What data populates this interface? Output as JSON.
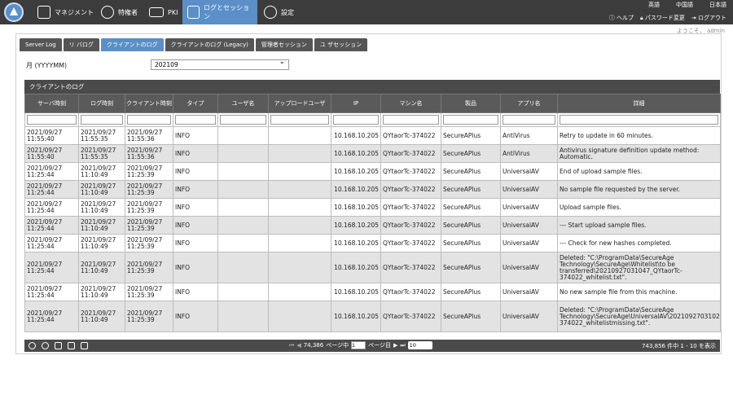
{
  "nav": {
    "items": [
      {
        "label": "マネジメント",
        "icon": "person-lock-icon",
        "active": false
      },
      {
        "label": "特権者",
        "icon": "admin-users-icon",
        "active": false
      },
      {
        "label": "PKI",
        "icon": "certificate-icon",
        "active": false
      },
      {
        "label": "ログとセッション",
        "icon": "log-icon",
        "active": true
      },
      {
        "label": "設定",
        "icon": "gear-icon",
        "active": false
      }
    ],
    "top_right_row1": [
      "英語",
      "中国語",
      "日本語"
    ],
    "help": "ヘルプ",
    "password_change": "パスワード変更",
    "logout": "ログアウト",
    "welcome": "ようこそ、 admin"
  },
  "tabs": [
    {
      "label": "Server Log",
      "active": false
    },
    {
      "label": "リ バログ",
      "active": false
    },
    {
      "label": "クライアントのログ",
      "active": true
    },
    {
      "label": "クライアントのログ (Legacy)",
      "active": false
    },
    {
      "label": "管理者セッション",
      "active": false
    },
    {
      "label": "ユ ザセッション",
      "active": false
    }
  ],
  "filter": {
    "month_label": "月 (YYYYMM)",
    "month_value": "202109"
  },
  "grid": {
    "title": "クライアントのログ",
    "columns": [
      "サーバ時刻",
      "ログ時刻",
      "クライアント時刻",
      "タイプ",
      "ユーザ名",
      "アップロードユーザ",
      "IP",
      "マシン名",
      "製品",
      "アプリ名",
      "詳細"
    ],
    "rows": [
      {
        "server": "2021/09/27 11:55:40",
        "log": "2021/09/27 11:55:35",
        "client": "2021/09/27 11:55:36",
        "type": "INFO",
        "user": "",
        "upload": "",
        "ip": "10.168.10.205",
        "machine": "QYtaorTc-374022",
        "product": "SecureAPlus",
        "app": "AntiVirus",
        "detail": "Retry to update in 60 minutes."
      },
      {
        "server": "2021/09/27 11:55:40",
        "log": "2021/09/27 11:55:35",
        "client": "2021/09/27 11:55:36",
        "type": "INFO",
        "user": "",
        "upload": "",
        "ip": "10.168.10.205",
        "machine": "QYtaorTc-374022",
        "product": "SecureAPlus",
        "app": "AntiVirus",
        "detail": "Antivirus signature definition update method: Automatic."
      },
      {
        "server": "2021/09/27 11:25:44",
        "log": "2021/09/27 11:10:49",
        "client": "2021/09/27 11:25:39",
        "type": "INFO",
        "user": "",
        "upload": "",
        "ip": "10.168.10.205",
        "machine": "QYtaorTc-374022",
        "product": "SecureAPlus",
        "app": "UniversalAV",
        "detail": "End of upload sample files."
      },
      {
        "server": "2021/09/27 11:25:44",
        "log": "2021/09/27 11:10:49",
        "client": "2021/09/27 11:25:39",
        "type": "INFO",
        "user": "",
        "upload": "",
        "ip": "10.168.10.205",
        "machine": "QYtaorTc-374022",
        "product": "SecureAPlus",
        "app": "UniversalAV",
        "detail": "No sample file requested by the server."
      },
      {
        "server": "2021/09/27 11:25:44",
        "log": "2021/09/27 11:10:49",
        "client": "2021/09/27 11:25:39",
        "type": "INFO",
        "user": "",
        "upload": "",
        "ip": "10.168.10.205",
        "machine": "QYtaorTc-374022",
        "product": "SecureAPlus",
        "app": "UniversalAV",
        "detail": "Upload sample files."
      },
      {
        "server": "2021/09/27 11:25:44",
        "log": "2021/09/27 11:10:49",
        "client": "2021/09/27 11:25:39",
        "type": "INFO",
        "user": "",
        "upload": "",
        "ip": "10.168.10.205",
        "machine": "QYtaorTc-374022",
        "product": "SecureAPlus",
        "app": "UniversalAV",
        "detail": "--- Start upload sample files."
      },
      {
        "server": "2021/09/27 11:25:44",
        "log": "2021/09/27 11:10:49",
        "client": "2021/09/27 11:25:39",
        "type": "INFO",
        "user": "",
        "upload": "",
        "ip": "10.168.10.205",
        "machine": "QYtaorTc-374022",
        "product": "SecureAPlus",
        "app": "UniversalAV",
        "detail": "--- Check for new hashes completed."
      },
      {
        "server": "2021/09/27 11:25:44",
        "log": "2021/09/27 11:10:49",
        "client": "2021/09/27 11:25:39",
        "type": "INFO",
        "user": "",
        "upload": "",
        "ip": "10.168.10.205",
        "machine": "QYtaorTc-374022",
        "product": "SecureAPlus",
        "app": "UniversalAV",
        "detail": "Deleted: \"C:\\ProgramData\\SecureAge Technology\\SecureAge\\Whitelist\\to be transferred\\20210927031047_QYtaorTc-374022_whitelist.txt\"."
      },
      {
        "server": "2021/09/27 11:25:44",
        "log": "2021/09/27 11:10:49",
        "client": "2021/09/27 11:25:39",
        "type": "INFO",
        "user": "",
        "upload": "",
        "ip": "10.168.10.205",
        "machine": "QYtaorTc-374022",
        "product": "SecureAPlus",
        "app": "UniversalAV",
        "detail": "No new sample file from this machine."
      },
      {
        "server": "2021/09/27 11:25:44",
        "log": "2021/09/27 11:10:49",
        "client": "2021/09/27 11:25:39",
        "type": "INFO",
        "user": "",
        "upload": "",
        "ip": "10.168.10.205",
        "machine": "QYtaorTc-374022",
        "product": "SecureAPlus",
        "app": "UniversalAV",
        "detail": "Deleted: \"C:\\ProgramData\\SecureAge Technology\\SecureAge\\UniversalAV\\20210927031025_qytaortc-374022_whitelistmissing.txt\"."
      }
    ]
  },
  "footer": {
    "total_pages": "74,386",
    "page_prefix": "ページ中",
    "current_page": "1",
    "page_suffix": "ページ目",
    "page_size": "10",
    "count_text": "743,856 件中 1 - 10 を表示"
  }
}
